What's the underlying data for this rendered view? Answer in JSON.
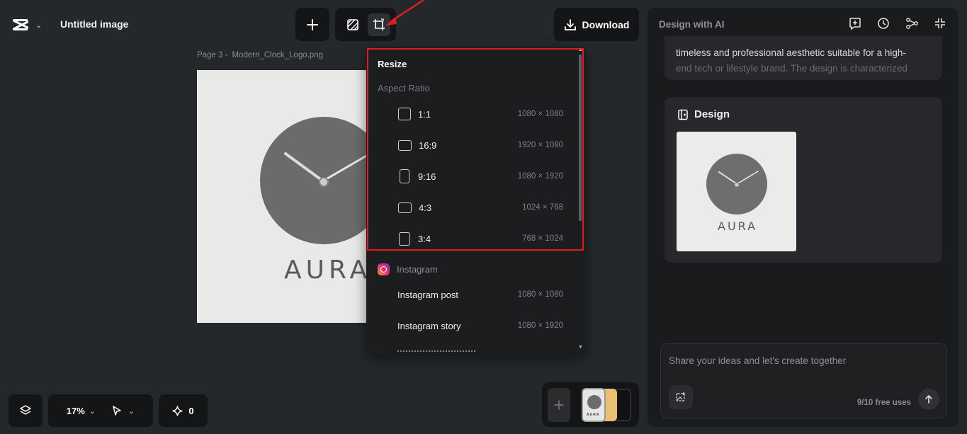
{
  "header": {
    "doc_title": "Untitled image",
    "download_label": "Download"
  },
  "canvas": {
    "page_number": "Page 3 -",
    "file_name": "Modern_Clock_Logo.png",
    "brand_text": "AURA"
  },
  "resize_menu": {
    "title": "Resize",
    "section_label": "Aspect Ratio",
    "ratios": [
      {
        "label": "1:1",
        "size": "1080 × 1080",
        "shape": "square"
      },
      {
        "label": "16:9",
        "size": "1920 × 1080",
        "shape": "wide"
      },
      {
        "label": "9:16",
        "size": "1080 × 1920",
        "shape": "tall"
      },
      {
        "label": "4:3",
        "size": "1024 × 768",
        "shape": "wide"
      },
      {
        "label": "3:4",
        "size": "768 × 1024",
        "shape": "square"
      }
    ],
    "instagram_section": "Instagram",
    "instagram_items": [
      {
        "label": "Instagram post",
        "size": "1080 × 1080"
      },
      {
        "label": "Instagram story",
        "size": "1080 × 1920"
      }
    ],
    "highlight_color": "#e11b22"
  },
  "right_panel": {
    "title": "Design with AI",
    "message_line1": "timeless and professional aesthetic suitable for a high-",
    "message_line2": "end tech or lifestyle brand. The design is characterized",
    "design_heading": "Design",
    "design_brand_text": "AURA",
    "composer_placeholder": "Share your ideas and let's create together",
    "free_uses": "9/10 free uses"
  },
  "bottom_bar": {
    "zoom": "17%",
    "ai_count": "0",
    "thumb_brand_text": "AURA"
  }
}
